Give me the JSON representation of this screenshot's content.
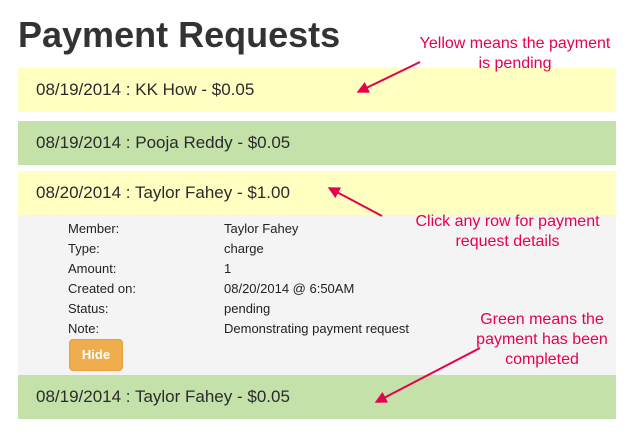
{
  "page": {
    "title": "Payment Requests"
  },
  "requests": [
    {
      "text": "08/19/2014 : KK How - $0.05",
      "state": "pending"
    },
    {
      "text": "08/19/2014 : Pooja Reddy - $0.05",
      "state": "completed"
    },
    {
      "text": "08/20/2014 : Taylor Fahey - $1.00",
      "state": "pending"
    },
    {
      "text": "08/19/2014 : Taylor Fahey - $0.05",
      "state": "completed"
    }
  ],
  "details": {
    "fields": [
      {
        "label": "Member:",
        "value": "Taylor Fahey"
      },
      {
        "label": "Type:",
        "value": "charge"
      },
      {
        "label": "Amount:",
        "value": "1"
      },
      {
        "label": "Created on:",
        "value": "08/20/2014 @ 6:50AM"
      },
      {
        "label": "Status:",
        "value": "pending"
      },
      {
        "label": "Note:",
        "value": "Demonstrating payment request"
      }
    ],
    "hide_label": "Hide"
  },
  "annotations": {
    "yellow_line1": "Yellow means the payment",
    "yellow_line2": "is pending",
    "click_line1": "Click any row for payment",
    "click_line2": "request details",
    "green_line1": "Green means the",
    "green_line2": "payment has been",
    "green_line3": "completed"
  },
  "colors": {
    "pending": "#ffffc2",
    "completed": "#c3e1a8",
    "annotation": "#e8004e",
    "hide_button": "#f0ad4e"
  }
}
